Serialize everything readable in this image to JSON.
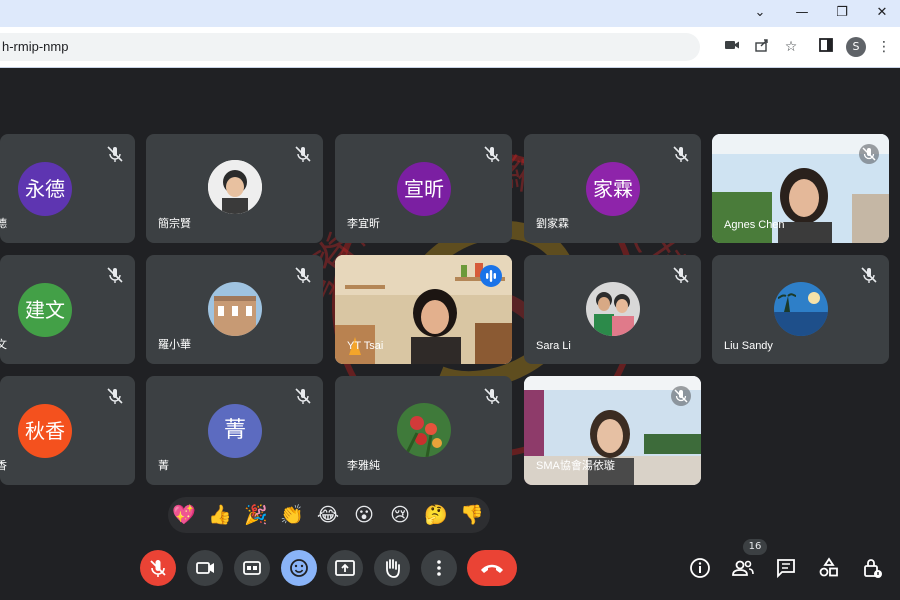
{
  "browser": {
    "url": "h-rmip-nmp",
    "profile_initial": "S"
  },
  "tiles": [
    {
      "name": "德",
      "avatar": "永德",
      "avatar_color": "#5e35b1"
    },
    {
      "name": "簡宗賢"
    },
    {
      "name": "李宜昕",
      "avatar": "宣昕",
      "avatar_color": "#7b1fa2"
    },
    {
      "name": "劉家霖",
      "avatar": "家霖",
      "avatar_color": "#8e24aa"
    },
    {
      "name": "Agnes Chen"
    },
    {
      "name": "文",
      "avatar": "建文",
      "avatar_color": "#43a047"
    },
    {
      "name": "羅小華"
    },
    {
      "name": "YT Tsai"
    },
    {
      "name": "Sara Li"
    },
    {
      "name": "Liu Sandy"
    },
    {
      "name": "香",
      "avatar": "秋香",
      "avatar_color": "#f4511e"
    },
    {
      "name": "菁",
      "avatar": "菁",
      "avatar_color": "#5c6bc0"
    },
    {
      "name": "李雅純"
    },
    {
      "name": "SMA協會湯依璇"
    }
  ],
  "reactions": [
    "💖",
    "👍",
    "🎉",
    "👏",
    "😂",
    "😮",
    "😢",
    "🤔",
    "👎"
  ],
  "participants_count": "16",
  "watermark_text": "台灣脊髓肌肉萎縮症病友協會"
}
